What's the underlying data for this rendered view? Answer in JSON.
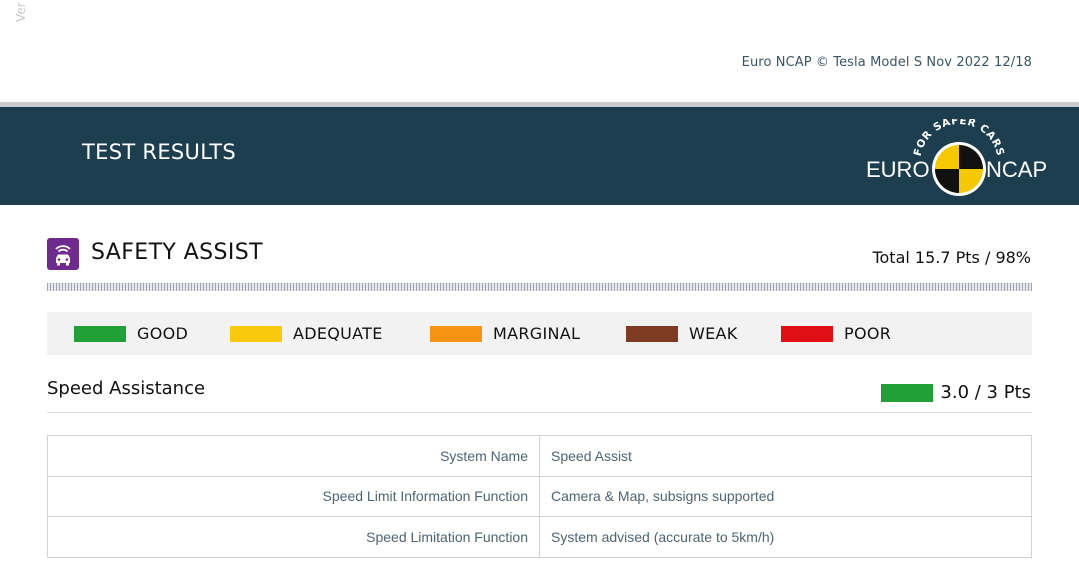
{
  "page": {
    "side_label": "Ver",
    "header_text": "Euro NCAP © Tesla Model S Nov 2022 12/18"
  },
  "banner": {
    "title": "TEST RESULTS",
    "logo": {
      "left_text": "EURO",
      "right_text": "NCAP",
      "arc_text": "FOR SAFER CARS",
      "colors": {
        "yellow": "#f6c800",
        "black": "#111111",
        "white": "#ffffff"
      }
    },
    "background_color": "#1c3e4f"
  },
  "section": {
    "icon": "car-wifi-icon",
    "icon_color": "#6e2a8c",
    "title": "SAFETY ASSIST",
    "total": "Total 15.7 Pts / 98%"
  },
  "legend": [
    {
      "label": "GOOD",
      "color": "#21a038"
    },
    {
      "label": "ADEQUATE",
      "color": "#f8c90d"
    },
    {
      "label": "MARGINAL",
      "color": "#f79414"
    },
    {
      "label": "WEAK",
      "color": "#7e3c22"
    },
    {
      "label": "POOR",
      "color": "#e00f13"
    }
  ],
  "subsection": {
    "title": "Speed Assistance",
    "rating_color": "#21a038",
    "score": "3.0 / 3 Pts"
  },
  "table": {
    "rows": [
      {
        "label": "System Name",
        "value": "Speed Assist"
      },
      {
        "label": "Speed Limit Information Function",
        "value": "Camera & Map, subsigns supported"
      },
      {
        "label": "Speed Limitation Function",
        "value": "System advised (accurate to 5km/h)"
      }
    ]
  }
}
